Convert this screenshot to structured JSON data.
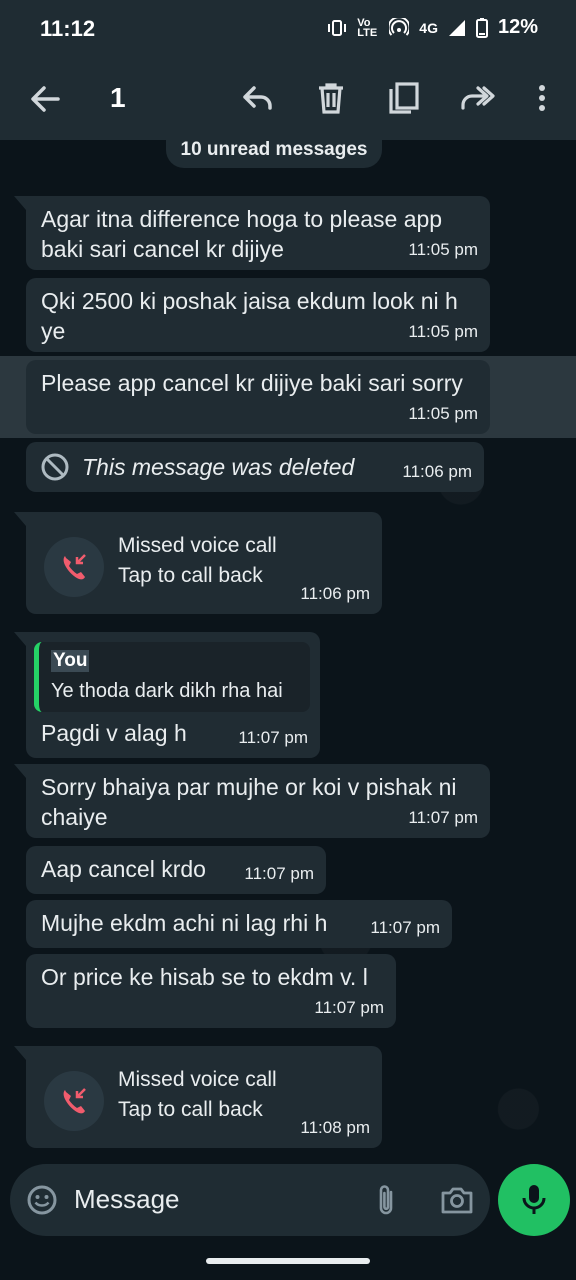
{
  "status_bar": {
    "time": "11:12",
    "volte": "Vo LTE",
    "network": "4G",
    "battery": "12%"
  },
  "app_bar": {
    "selected_count": "1",
    "icons": [
      "back-arrow-icon",
      "reply-icon",
      "delete-icon",
      "copy-icon",
      "forward-icon",
      "more-vert-icon"
    ]
  },
  "unread_banner": "10 unread messages",
  "messages": [
    {
      "text": "Agar itna difference hoga to please app baki sari cancel kr dijiye",
      "time": "11:05 pm"
    },
    {
      "text": "Qki 2500 ki poshak jaisa ekdum look ni h ye",
      "time": "11:05 pm"
    },
    {
      "text": "Please app cancel kr dijiye baki sari sorry",
      "time": "11:05 pm"
    },
    {
      "text": "This message was deleted",
      "time": "11:06 pm"
    },
    {
      "call_title": "Missed voice call",
      "call_sub": "Tap to call back",
      "time": "11:06 pm"
    },
    {
      "quote_name": "You",
      "quote_text": "Ye thoda dark dikh rha hai",
      "text": "Pagdi v alag h",
      "time": "11:07 pm"
    },
    {
      "text": "Sorry bhaiya par mujhe or koi v pishak ni chaiye",
      "time": "11:07 pm"
    },
    {
      "text": "Aap cancel krdo",
      "time": "11:07 pm"
    },
    {
      "text": "Mujhe ekdm achi ni lag rhi h",
      "time": "11:07 pm"
    },
    {
      "text": "Or price ke hisab se to ekdm v. l",
      "time": "11:07 pm"
    },
    {
      "call_title": "Missed voice call",
      "call_sub": "Tap to call back",
      "time": "11:08 pm"
    }
  ],
  "input": {
    "placeholder": "Message"
  },
  "colors": {
    "background": "#0b141a",
    "bar": "#1f2c33",
    "bubble": "#202c33",
    "accent": "#21c063",
    "missed_call": "#f15c6d"
  }
}
